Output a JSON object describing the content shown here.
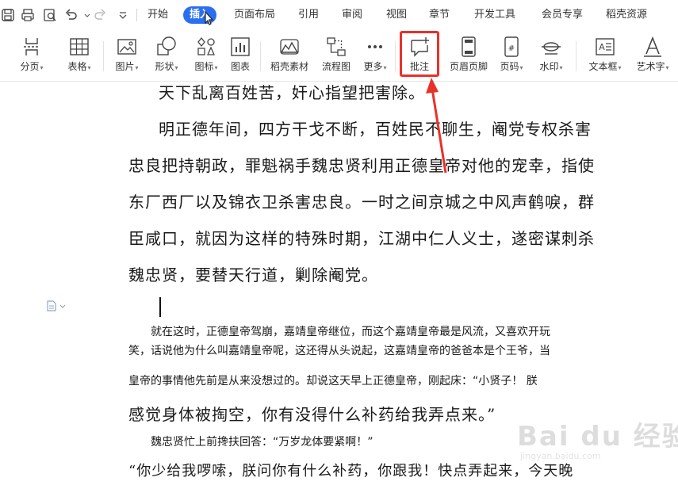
{
  "menubar": {
    "tabs": [
      "开始",
      "插入",
      "页面布局",
      "引用",
      "审阅",
      "视图",
      "章节",
      "开发工具",
      "会员专享",
      "稻壳资源"
    ],
    "active_tab": "插入"
  },
  "ribbon": {
    "page": "分页",
    "table": "表格",
    "picture": "图片",
    "shape": "形状",
    "icon": "图标",
    "chart": "图表",
    "material": "稻壳素材",
    "flowchart": "流程图",
    "more": "更多",
    "comment": "批注",
    "header_footer": "页眉页脚",
    "page_number": "页码",
    "watermark": "水印",
    "textbox": "文本框",
    "wordart": "艺术字"
  },
  "document": {
    "lines_big": [
      "天下乱离百姓苦，奸心指望把害除。",
      "明正德年间，四方干戈不断，百姓民不聊生，阉党专权杀害",
      "忠良把持朝政，罪魁祸手魏忠贤利用正德皇帝对他的宠幸，指使",
      "东厂西厂以及锦衣卫杀害忠良。一时之间京城之中风声鹤唳，群",
      "臣咸口，就因为这样的特殊时期，江湖中仁人义士，遂密谋刺杀",
      "魏忠贤，要替天行道，剿除阉党。"
    ],
    "lines_small": [
      "就在这时，正德皇帝驾崩，嘉靖皇帝继位，而这个嘉靖皇帝最是风流，又喜欢开玩",
      "笑，话说他为什么叫嘉靖皇帝呢，这还得从头说起，这嘉靖皇帝的爸爸本是个王爷，当",
      "皇帝的事情他先前是从来没想过的。却说这天早上正德皇帝，刚起床：“小贤子！ 朕"
    ],
    "line_big_7": "感觉身体被掏空，你有没得什么补药给我弄点来。”",
    "line_small_4": "魏忠贤忙上前搀扶回答：“万岁龙体要紧啊！”",
    "line_big_8": "“你少给我啰嗦，朕问你有什么补药，你跟我！快点弄起来，今天晚"
  },
  "watermark": {
    "text": "Bai du 经验",
    "sub": "jingyan.baidu.com"
  },
  "colors": {
    "active_tab": "#2a6ff0",
    "highlight": "#e8312a"
  }
}
